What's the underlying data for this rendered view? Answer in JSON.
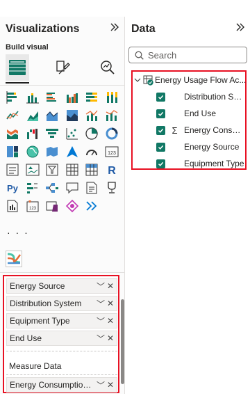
{
  "visualizations": {
    "title": "Visualizations",
    "build_visual_label": "Build visual",
    "more_visuals": "· · ·",
    "build_tabs": [
      {
        "name": "build-visual-tab",
        "icon": "table-build-icon",
        "active": true
      },
      {
        "name": "format-visual-tab",
        "icon": "paintbrush-icon",
        "active": false
      },
      {
        "name": "analytics-tab",
        "icon": "magnifier-chart-icon",
        "active": false
      }
    ],
    "wells": {
      "fields": [
        "Energy Source",
        "Distribution System",
        "Equipment Type",
        "End Use"
      ],
      "measure_label": "Measure Data",
      "measure_field": "Energy Consumption ..."
    }
  },
  "data": {
    "title": "Data",
    "search_placeholder": "Search",
    "table": {
      "name": "Energy Usage Flow Ac...",
      "fields": [
        {
          "label": "Distribution Sys...",
          "checked": true,
          "sigma": false
        },
        {
          "label": "End Use",
          "checked": true,
          "sigma": false
        },
        {
          "label": "Energy Consum...",
          "checked": true,
          "sigma": true
        },
        {
          "label": "Energy Source",
          "checked": true,
          "sigma": false
        },
        {
          "label": "Equipment Type",
          "checked": true,
          "sigma": false
        }
      ]
    }
  },
  "icons": {
    "collapse": "double-chevron-right-icon",
    "well_dropdown": "chevron-down-icon",
    "well_remove": "close-icon",
    "checked": "checkbox-checked-icon",
    "sigma": "sigma-icon"
  },
  "colors": {
    "highlight_border": "#e81123",
    "checkbox": "#117865"
  }
}
